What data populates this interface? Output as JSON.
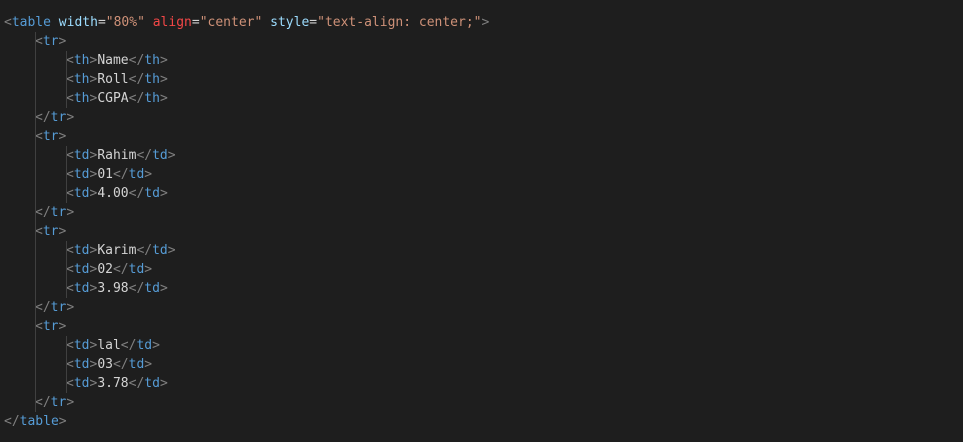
{
  "colors": {
    "background": "#1e1e1e",
    "bracket": "#808080",
    "tag": "#569cd6",
    "attribute": "#9cdcfe",
    "attribute_highlight": "#f44747",
    "value": "#ce9178",
    "text": "#d4d4d4"
  },
  "code": {
    "open_table": {
      "tag": "table",
      "attr1_name": "width",
      "attr1_value": "\"80%\"",
      "attr2_name": "align",
      "attr2_value": "\"center\"",
      "attr3_name": "style",
      "attr3_value": "\"text-align: center;\""
    },
    "rows": [
      {
        "cell_tag": "th",
        "cells": [
          "Name",
          "Roll",
          "CGPA"
        ]
      },
      {
        "cell_tag": "td",
        "cells": [
          "Rahim",
          "01",
          "4.00"
        ]
      },
      {
        "cell_tag": "td",
        "cells": [
          "Karim",
          "02",
          "3.98"
        ]
      },
      {
        "cell_tag": "td",
        "cells": [
          "lal",
          "03",
          "3.78"
        ]
      }
    ],
    "row_tag": "tr",
    "close_table_tag": "table"
  }
}
